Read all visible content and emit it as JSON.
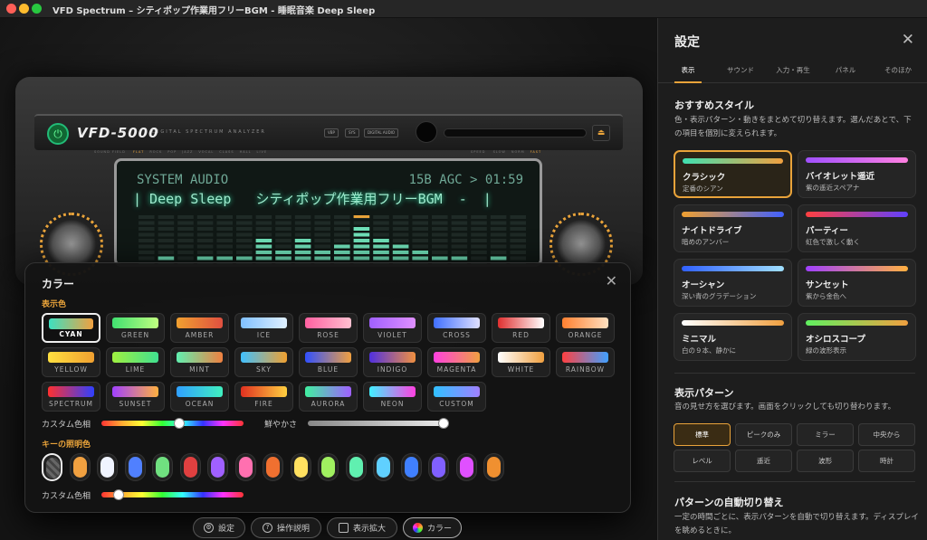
{
  "window": {
    "title": "VFD Spectrum – シティポップ作業用フリーBGM  -  睡眠音楽 Deep Sleep"
  },
  "colors": {
    "accent": "#e9a33a",
    "vfd_text": "#9ce9cc",
    "panel_bg": "#1d1d1d"
  },
  "device": {
    "brand": "VFD-5000",
    "subtitle": "DIGITAL SPECTRUM ANALYZER",
    "chips": [
      "VBP",
      "SYS",
      "DIGITAL AUDIO"
    ],
    "left_ctl_label": "SOUND FIELD",
    "left_ctl_items": [
      "FLAT",
      "ROCK",
      "POP",
      "JAZZ",
      "VOCAL",
      "CLASS",
      "HALL",
      "LIVE"
    ],
    "right_ctl_label": "SPEED",
    "right_ctl_items": [
      "SLOW",
      "NORM",
      "FAST"
    ],
    "display": {
      "line1_left": "SYSTEM AUDIO",
      "line1_right": "15B AGC > 01:59",
      "line2": "| Deep Sleep   シティポップ作業用フリーBGM  -  |"
    },
    "spectrum_levels": [
      0.1,
      0.15,
      0.1,
      0.15,
      0.2,
      0.2,
      0.55,
      0.3,
      0.45,
      0.3,
      0.4,
      0.7,
      0.55,
      0.4,
      0.3,
      0.2,
      0.15,
      0.1,
      0.15,
      0.1
    ],
    "spectrum_peak_index": 11
  },
  "color_modal": {
    "title": "カラー",
    "close_icon": "close-icon",
    "display_color_label": "表示色",
    "tiles": [
      {
        "label": "CYAN",
        "grad": [
          "#3de0c0",
          "#f0a040"
        ],
        "selected": true
      },
      {
        "label": "GREEN",
        "grad": [
          "#40e070",
          "#c0ff80"
        ],
        "selected": false
      },
      {
        "label": "AMBER",
        "grad": [
          "#f0a030",
          "#e05040"
        ],
        "selected": false
      },
      {
        "label": "ICE",
        "grad": [
          "#80c0ff",
          "#e0f0ff"
        ],
        "selected": false
      },
      {
        "label": "ROSE",
        "grad": [
          "#ff60a0",
          "#ffc0d0"
        ],
        "selected": false
      },
      {
        "label": "VIOLET",
        "grad": [
          "#a060ff",
          "#e090ff"
        ],
        "selected": false
      },
      {
        "label": "CROSS",
        "grad": [
          "#4070ff",
          "#e0e0ff"
        ],
        "selected": false
      },
      {
        "label": "RED",
        "grad": [
          "#e03030",
          "#ffffff"
        ],
        "selected": false
      },
      {
        "label": "ORANGE",
        "grad": [
          "#ff8030",
          "#ffe0c0"
        ],
        "selected": false
      },
      {
        "label": "YELLOW",
        "grad": [
          "#ffe040",
          "#f0a030"
        ],
        "selected": false
      },
      {
        "label": "LIME",
        "grad": [
          "#a0f040",
          "#40e090"
        ],
        "selected": false
      },
      {
        "label": "MINT",
        "grad": [
          "#60f0b0",
          "#f08040"
        ],
        "selected": false
      },
      {
        "label": "SKY",
        "grad": [
          "#40c0ff",
          "#f0a030"
        ],
        "selected": false
      },
      {
        "label": "BLUE",
        "grad": [
          "#3050ff",
          "#f0a040"
        ],
        "selected": false
      },
      {
        "label": "INDIGO",
        "grad": [
          "#5030e0",
          "#f09040"
        ],
        "selected": false
      },
      {
        "label": "MAGENTA",
        "grad": [
          "#ff40e0",
          "#f0a040"
        ],
        "selected": false
      },
      {
        "label": "WHITE",
        "grad": [
          "#ffffff",
          "#f0a040"
        ],
        "selected": false
      },
      {
        "label": "RAINBOW",
        "grad": [
          "#ff4040",
          "#40a0ff"
        ],
        "selected": false
      },
      {
        "label": "SPECTRUM",
        "grad": [
          "#ff3030",
          "#3040ff"
        ],
        "selected": false
      },
      {
        "label": "SUNSET",
        "grad": [
          "#a040ff",
          "#ffb040"
        ],
        "selected": false
      },
      {
        "label": "OCEAN",
        "grad": [
          "#30a0ff",
          "#40f0c0"
        ],
        "selected": false
      },
      {
        "label": "FIRE",
        "grad": [
          "#e03020",
          "#ffd040"
        ],
        "selected": false
      },
      {
        "label": "AURORA",
        "grad": [
          "#40f0a0",
          "#a060ff"
        ],
        "selected": false
      },
      {
        "label": "NEON",
        "grad": [
          "#40f0ff",
          "#ff40e0"
        ],
        "selected": false
      },
      {
        "label": "CUSTOM",
        "grad": [
          "#30c0ff",
          "#a080ff"
        ],
        "selected": false
      }
    ],
    "custom_hue_label": "カスタム色相",
    "custom_hue_value": 0.55,
    "saturation_label": "鮮やかさ",
    "saturation_value": 0.97,
    "key_light_label": "キーの照明色",
    "key_colors": [
      "#555555",
      "#f0a040",
      "#f0f4ff",
      "#5080ff",
      "#70e080",
      "#e04040",
      "#a060ff",
      "#ff70b0",
      "#f07030",
      "#ffe060",
      "#a0f060",
      "#60f0b0",
      "#60d0ff",
      "#4080ff",
      "#8060ff",
      "#e050ff",
      "#f09030"
    ],
    "key_selected_index": 0,
    "key_custom_hue_label": "カスタム色相",
    "key_custom_hue_value": 0.12
  },
  "bottom_bar": [
    {
      "icon": "gear-icon",
      "label": "設定"
    },
    {
      "icon": "help-icon",
      "label": "操作説明"
    },
    {
      "icon": "expand-icon",
      "label": "表示拡大"
    },
    {
      "icon": "palette-icon",
      "label": "カラー"
    }
  ],
  "settings": {
    "title": "設定",
    "tabs": [
      "表示",
      "サウンド",
      "入力・再生",
      "パネル",
      "そのほか"
    ],
    "active_tab": 0,
    "style_heading": "おすすめスタイル",
    "style_desc": "色・表示パターン・動きをまとめて切り替えます。選んだあとで、下の項目を個別に変えられます。",
    "styles": [
      {
        "name": "クラシック",
        "desc": "定番のシアン",
        "grad": [
          "#40e0b0",
          "#f0a040"
        ],
        "selected": true
      },
      {
        "name": "バイオレット遥近",
        "desc": "紫の遥近スペアナ",
        "grad": [
          "#a050ff",
          "#ff80e0"
        ],
        "selected": false
      },
      {
        "name": "ナイトドライブ",
        "desc": "暗めのアンバー",
        "grad": [
          "#f0a030",
          "#4060ff"
        ],
        "selected": false
      },
      {
        "name": "パーティー",
        "desc": "虹色で激しく動く",
        "grad": [
          "#ff4040",
          "#6040ff"
        ],
        "selected": false
      },
      {
        "name": "オーシャン",
        "desc": "深い青のグラデーション",
        "grad": [
          "#3060ff",
          "#a0e0ff"
        ],
        "selected": false
      },
      {
        "name": "サンセット",
        "desc": "紫から金色へ",
        "grad": [
          "#a040ff",
          "#ffb040"
        ],
        "selected": false
      },
      {
        "name": "ミニマル",
        "desc": "白の９本、静かに",
        "grad": [
          "#ffffff",
          "#f0a040"
        ],
        "selected": false
      },
      {
        "name": "オシロスコープ",
        "desc": "緑の波形表示",
        "grad": [
          "#60f060",
          "#f0a040"
        ],
        "selected": false
      }
    ],
    "pattern_heading": "表示パターン",
    "pattern_desc": "音の見せ方を選びます。画面をクリックしても切り替わります。",
    "patterns": [
      "標準",
      "ピークのみ",
      "ミラー",
      "中央から",
      "レベル",
      "遥近",
      "波形",
      "時計"
    ],
    "pattern_selected": 0,
    "auto_heading": "パターンの自動切り替え",
    "auto_desc": "一定の時間ごとに、表示パターンを自動で切り替えます。ディスプレイを眺めるときに。"
  }
}
